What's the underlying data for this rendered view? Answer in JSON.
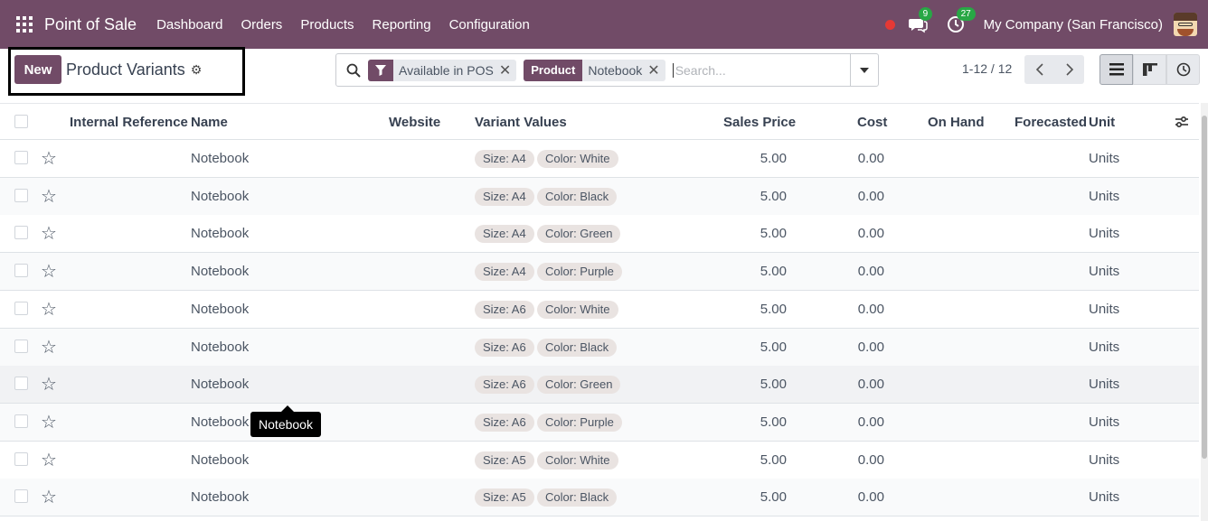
{
  "navbar": {
    "app_name": "Point of Sale",
    "menu": [
      "Dashboard",
      "Orders",
      "Products",
      "Reporting",
      "Configuration"
    ],
    "messages_count": "9",
    "activities_count": "27",
    "company": "My Company (San Francisco)",
    "accent_color": "#714B67"
  },
  "control": {
    "new_label": "New",
    "breadcrumb": "Product Variants",
    "filters": [
      {
        "label": "",
        "value": "Available in POS",
        "icon": "filter-icon"
      },
      {
        "label": "Product",
        "value": "Notebook"
      }
    ],
    "search_placeholder": "Search...",
    "pager": "1-12 / 12"
  },
  "table": {
    "headers": {
      "internal_reference": "Internal Reference",
      "name": "Name",
      "website": "Website",
      "variant_values": "Variant Values",
      "sales_price": "Sales Price",
      "cost": "Cost",
      "on_hand": "On Hand",
      "forecasted": "Forecasted",
      "unit": "Unit"
    },
    "rows": [
      {
        "name": "Notebook",
        "size": "Size: A4",
        "color": "Color: White",
        "price": "5.00",
        "cost": "0.00",
        "unit": "Units"
      },
      {
        "name": "Notebook",
        "size": "Size: A4",
        "color": "Color: Black",
        "price": "5.00",
        "cost": "0.00",
        "unit": "Units"
      },
      {
        "name": "Notebook",
        "size": "Size: A4",
        "color": "Color: Green",
        "price": "5.00",
        "cost": "0.00",
        "unit": "Units"
      },
      {
        "name": "Notebook",
        "size": "Size: A4",
        "color": "Color: Purple",
        "price": "5.00",
        "cost": "0.00",
        "unit": "Units"
      },
      {
        "name": "Notebook",
        "size": "Size: A6",
        "color": "Color: White",
        "price": "5.00",
        "cost": "0.00",
        "unit": "Units"
      },
      {
        "name": "Notebook",
        "size": "Size: A6",
        "color": "Color: Black",
        "price": "5.00",
        "cost": "0.00",
        "unit": "Units"
      },
      {
        "name": "Notebook",
        "size": "Size: A6",
        "color": "Color: Green",
        "price": "5.00",
        "cost": "0.00",
        "unit": "Units"
      },
      {
        "name": "Notebook",
        "size": "Size: A6",
        "color": "Color: Purple",
        "price": "5.00",
        "cost": "0.00",
        "unit": "Units"
      },
      {
        "name": "Notebook",
        "size": "Size: A5",
        "color": "Color: White",
        "price": "5.00",
        "cost": "0.00",
        "unit": "Units"
      },
      {
        "name": "Notebook",
        "size": "Size: A5",
        "color": "Color: Black",
        "price": "5.00",
        "cost": "0.00",
        "unit": "Units"
      }
    ]
  },
  "tooltip": "Notebook"
}
